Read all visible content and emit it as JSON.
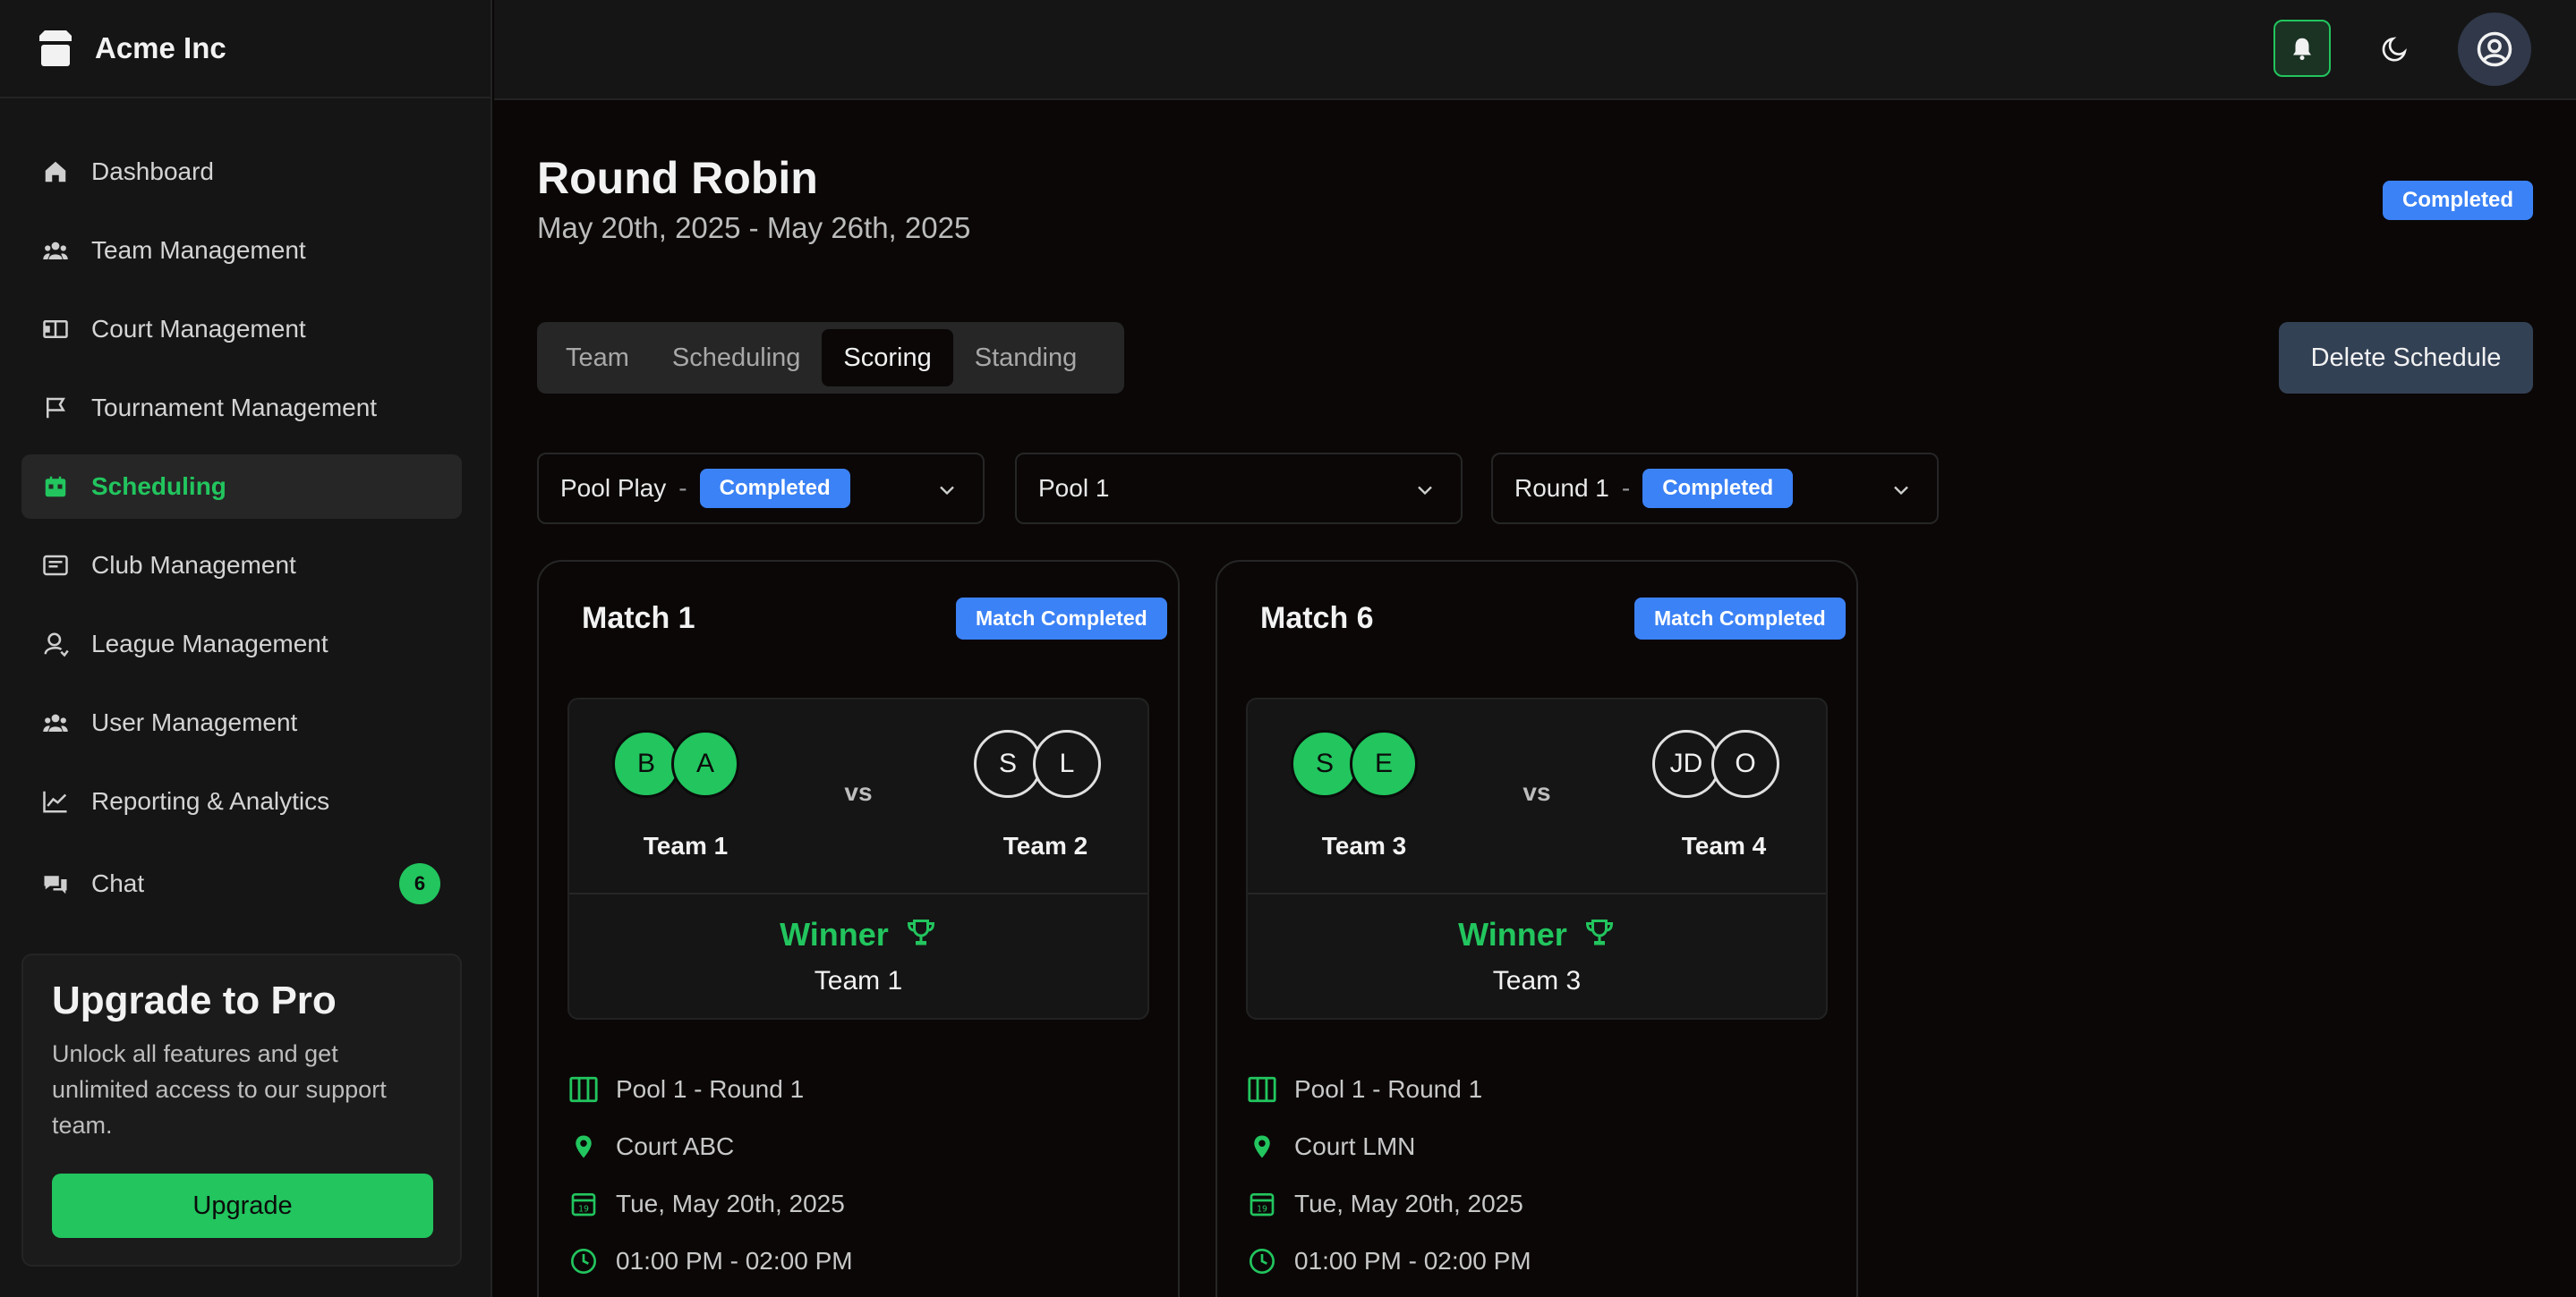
{
  "brand": {
    "name": "Acme Inc"
  },
  "sidebar": {
    "items": [
      {
        "label": "Dashboard",
        "icon": "home-icon"
      },
      {
        "label": "Team Management",
        "icon": "users-icon"
      },
      {
        "label": "Court Management",
        "icon": "court-icon"
      },
      {
        "label": "Tournament Management",
        "icon": "flag-icon"
      },
      {
        "label": "Scheduling",
        "icon": "calendar-icon",
        "active": true
      },
      {
        "label": "Club Management",
        "icon": "club-icon"
      },
      {
        "label": "League Management",
        "icon": "league-icon"
      },
      {
        "label": "User Management",
        "icon": "users-icon"
      },
      {
        "label": "Reporting & Analytics",
        "icon": "chart-line-icon"
      },
      {
        "label": "Chat",
        "icon": "chat-icon",
        "badge": "6"
      }
    ],
    "upgrade": {
      "title": "Upgrade to Pro",
      "text": "Unlock all features and get unlimited access to our support team.",
      "button": "Upgrade"
    }
  },
  "page": {
    "title": "Round Robin",
    "dates": "May 20th, 2025 - May 26th, 2025",
    "status": "Completed",
    "tabs": [
      "Team",
      "Scheduling",
      "Scoring",
      "Standing"
    ],
    "active_tab": "Scoring",
    "delete_button": "Delete Schedule"
  },
  "filters": {
    "phase": {
      "label": "Pool Play",
      "sep": "-",
      "status": "Completed"
    },
    "pool": {
      "label": "Pool 1"
    },
    "round": {
      "label": "Round 1",
      "sep": "-",
      "status": "Completed"
    }
  },
  "matches": [
    {
      "title": "Match 1",
      "status": "Match Completed",
      "team_a": {
        "name": "Team 1",
        "initials": [
          "B",
          "A"
        ]
      },
      "vs": "vs",
      "team_b": {
        "name": "Team 2",
        "initials": [
          "S",
          "L"
        ]
      },
      "winner_label": "Winner",
      "winner": "Team 1",
      "pool_round": "Pool 1 - Round 1",
      "court": "Court ABC",
      "date": "Tue, May 20th, 2025",
      "time": "01:00 PM - 02:00 PM"
    },
    {
      "title": "Match 6",
      "status": "Match Completed",
      "team_a": {
        "name": "Team 3",
        "initials": [
          "S",
          "E"
        ]
      },
      "vs": "vs",
      "team_b": {
        "name": "Team 4",
        "initials": [
          "JD",
          "O"
        ]
      },
      "winner_label": "Winner",
      "winner": "Team 3",
      "pool_round": "Pool 1 - Round 1",
      "court": "Court LMN",
      "date": "Tue, May 20th, 2025",
      "time": "01:00 PM - 02:00 PM"
    }
  ],
  "colors": {
    "accent": "#22c55e",
    "badge_blue": "#3b82f6",
    "background": "#0b0707"
  }
}
